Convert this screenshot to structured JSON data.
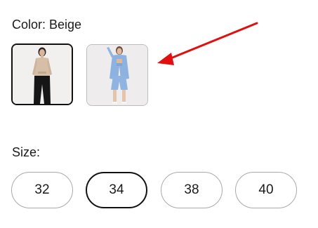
{
  "color": {
    "label": "Color: Beige",
    "swatches": [
      {
        "name": "Beige",
        "selected": true,
        "top_color": "#d8c2ab",
        "bottom_color": "#1b1b1b"
      },
      {
        "name": "Blue",
        "selected": false,
        "outfit_color": "#8fb4e0"
      }
    ]
  },
  "size": {
    "label": "Size:",
    "options": [
      "32",
      "34",
      "38",
      "40"
    ],
    "selected": "34"
  },
  "annotation": {
    "arrow_color": "#e01010"
  }
}
